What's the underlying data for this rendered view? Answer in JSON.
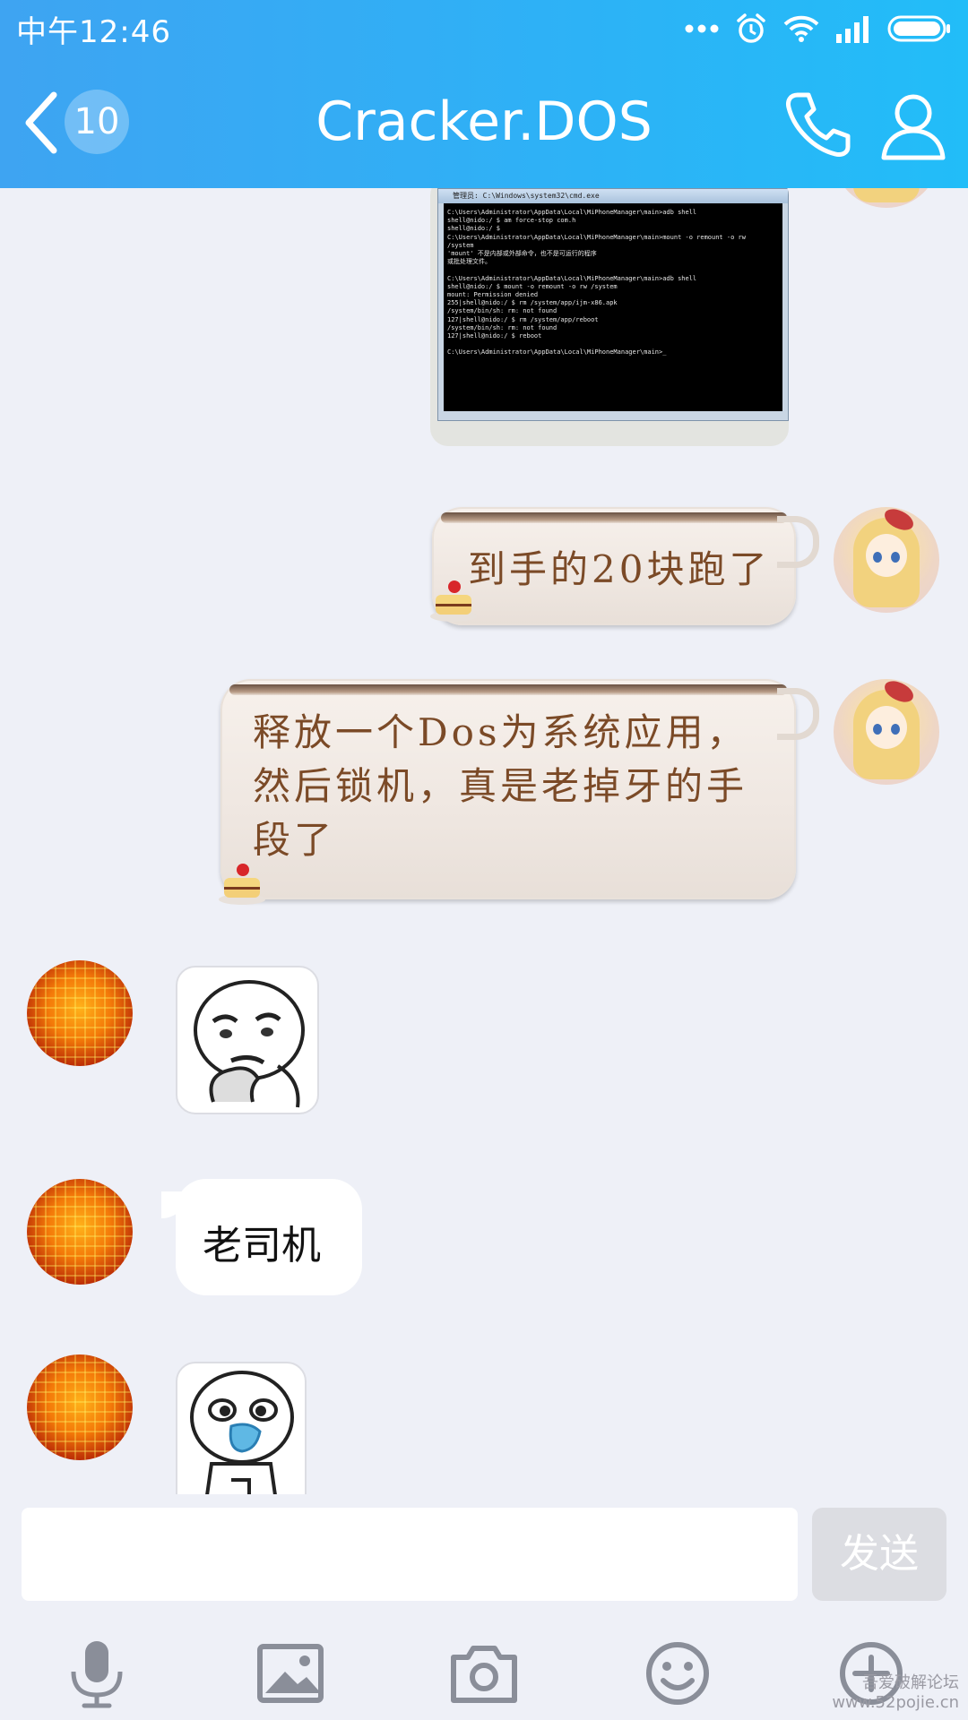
{
  "status_bar": {
    "time": "中午12:46"
  },
  "header": {
    "unread_count": "10",
    "title": "Cracker.DOS"
  },
  "messages": {
    "screenshot": {
      "window_title": "管理员: C:\\Windows\\system32\\cmd.exe",
      "console_text": "C:\\Users\\Administrator\\AppData\\Local\\MiPhoneManager\\main>adb shell\nshell@nido:/ $ am force-stop com.h\nshell@nido:/ $\nC:\\Users\\Administrator\\AppData\\Local\\MiPhoneManager\\main>mount -o remount -o rw\n/system\n'mount' 不是内部或外部命令，也不是可运行的程序\n或批处理文件。\n\nC:\\Users\\Administrator\\AppData\\Local\\MiPhoneManager\\main>adb shell\nshell@nido:/ $ mount -o remount -o rw /system\nmount: Permission denied\n255|shell@nido:/ $ rm /system/app/ijm-x86.apk\n/system/bin/sh: rm: not found\n127|shell@nido:/ $ rm /system/app/reboot\n/system/bin/sh: rm: not found\n127|shell@nido:/ $ reboot\n\nC:\\Users\\Administrator\\AppData\\Local\\MiPhoneManager\\main>_"
    },
    "self_1": "到手的20块跑了",
    "self_2_line1": "释放一个Dos为系统应用，",
    "self_2_line2": "然后锁机，真是老掉牙的手",
    "self_2_line3": "段了",
    "friend_text": "老司机"
  },
  "input": {
    "send_label": "发送"
  },
  "watermark": {
    "line1": "吾爱破解论坛",
    "line2": "www.52pojie.cn"
  },
  "colors": {
    "header_accent": "#2db2f6",
    "chat_background": "#eef0f7",
    "send_disabled": "#dcdde2",
    "cup_text": "#7b4a27"
  },
  "icons": {
    "toolbar": [
      "microphone-icon",
      "image-icon",
      "camera-icon",
      "emoji-icon",
      "plus-icon"
    ],
    "header": [
      "back-icon",
      "phone-icon",
      "profile-icon"
    ]
  }
}
